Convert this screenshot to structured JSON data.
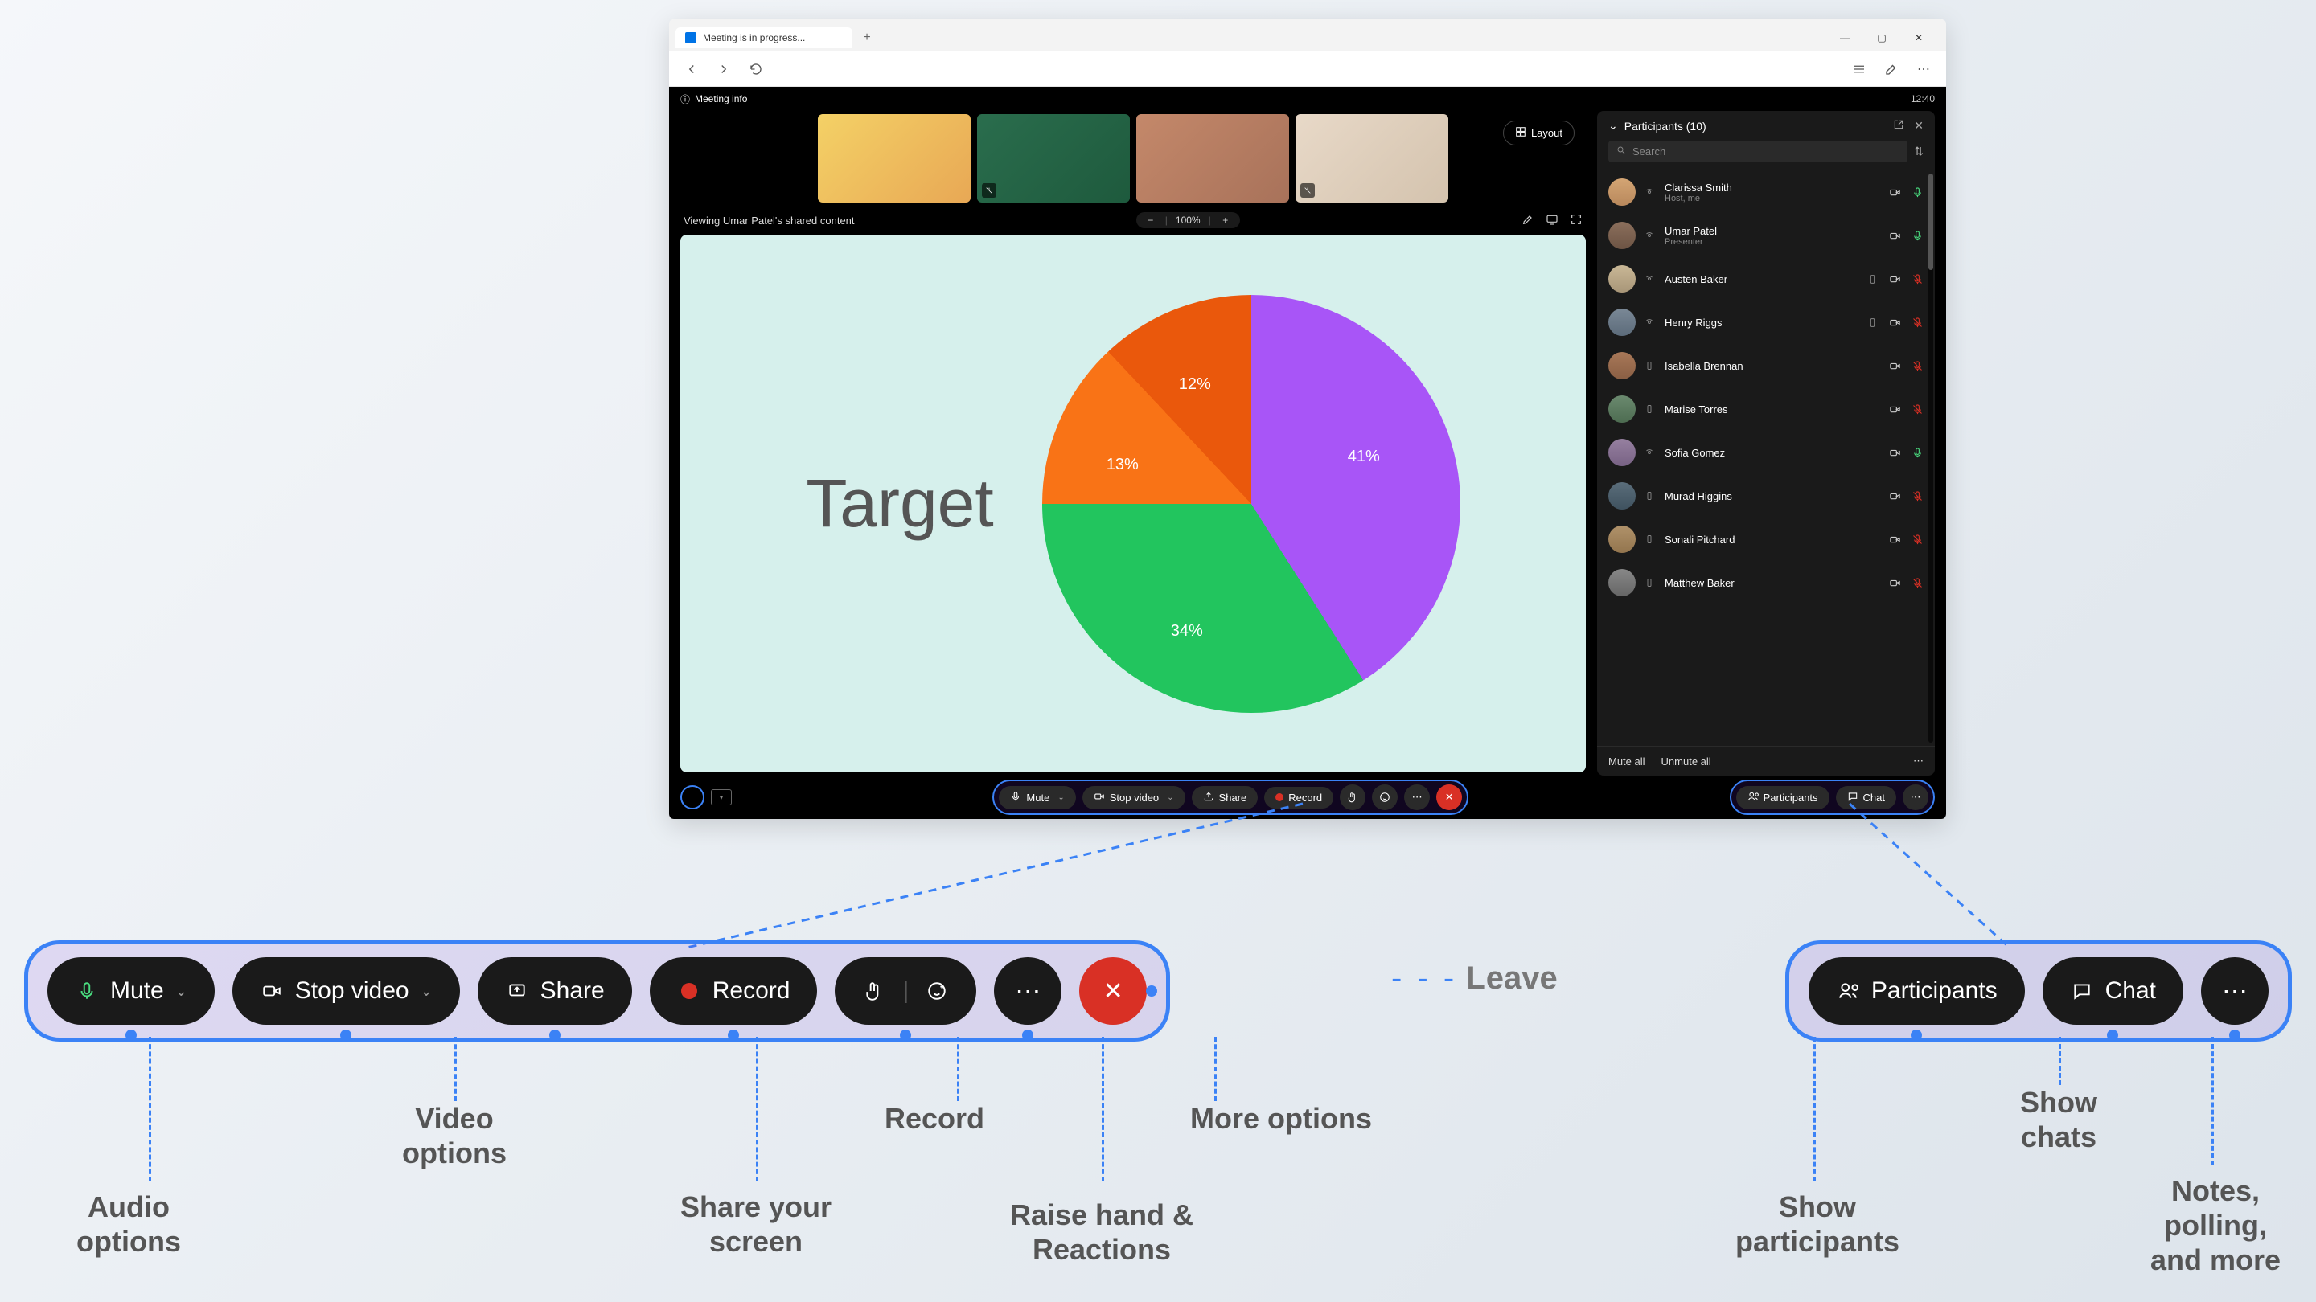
{
  "browser": {
    "tab_title": "Meeting is in progress...",
    "new_tab": "+"
  },
  "meeting": {
    "info_label": "Meeting info",
    "time": "12:40",
    "layout_btn": "Layout",
    "viewing_label": "Viewing Umar Patel's shared content",
    "zoom": {
      "minus": "−",
      "value": "100%",
      "plus": "+"
    },
    "slide_title": "Target"
  },
  "chart_data": {
    "type": "pie",
    "title": "Target",
    "slices": [
      {
        "label": "41%",
        "value": 41,
        "color": "#a855f7"
      },
      {
        "label": "34%",
        "value": 34,
        "color": "#22c55e"
      },
      {
        "label": "13%",
        "value": 13,
        "color": "#f97316"
      },
      {
        "label": "12%",
        "value": 12,
        "color": "#ea580c"
      }
    ]
  },
  "participants_panel": {
    "title": "Participants (10)",
    "search_placeholder": "Search",
    "mute_all": "Mute all",
    "unmute_all": "Unmute all",
    "list": [
      {
        "name": "Clarissa Smith",
        "role": "Host, me",
        "net": true,
        "phone": false,
        "cam": "on",
        "mic": "on"
      },
      {
        "name": "Umar Patel",
        "role": "Presenter",
        "net": true,
        "phone": false,
        "cam": "on",
        "mic": "on"
      },
      {
        "name": "Austen Baker",
        "role": "",
        "net": true,
        "phone": true,
        "cam": "on",
        "mic": "muted"
      },
      {
        "name": "Henry Riggs",
        "role": "",
        "net": true,
        "phone": true,
        "cam": "on",
        "mic": "muted"
      },
      {
        "name": "Isabella Brennan",
        "role": "",
        "net": false,
        "phone": true,
        "cam": "on",
        "mic": "muted"
      },
      {
        "name": "Marise Torres",
        "role": "",
        "net": false,
        "phone": true,
        "cam": "on",
        "mic": "muted"
      },
      {
        "name": "Sofia Gomez",
        "role": "",
        "net": true,
        "phone": false,
        "cam": "on",
        "mic": "on"
      },
      {
        "name": "Murad Higgins",
        "role": "",
        "net": false,
        "phone": true,
        "cam": "on",
        "mic": "muted"
      },
      {
        "name": "Sonali Pitchard",
        "role": "",
        "net": false,
        "phone": true,
        "cam": "on",
        "mic": "muted"
      },
      {
        "name": "Matthew Baker",
        "role": "",
        "net": false,
        "phone": true,
        "cam": "on",
        "mic": "muted"
      }
    ]
  },
  "controls": {
    "mute": "Mute",
    "stop_video": "Stop video",
    "share": "Share",
    "record": "Record",
    "participants": "Participants",
    "chat": "Chat"
  },
  "callouts": {
    "leave": "Leave",
    "audio": "Audio options",
    "video": "Video options",
    "share": "Share your screen",
    "record": "Record",
    "raise": "Raise hand & Reactions",
    "more": "More options",
    "show_participants": "Show participants",
    "show_chats": "Show chats",
    "notes": "Notes, polling, and more"
  }
}
